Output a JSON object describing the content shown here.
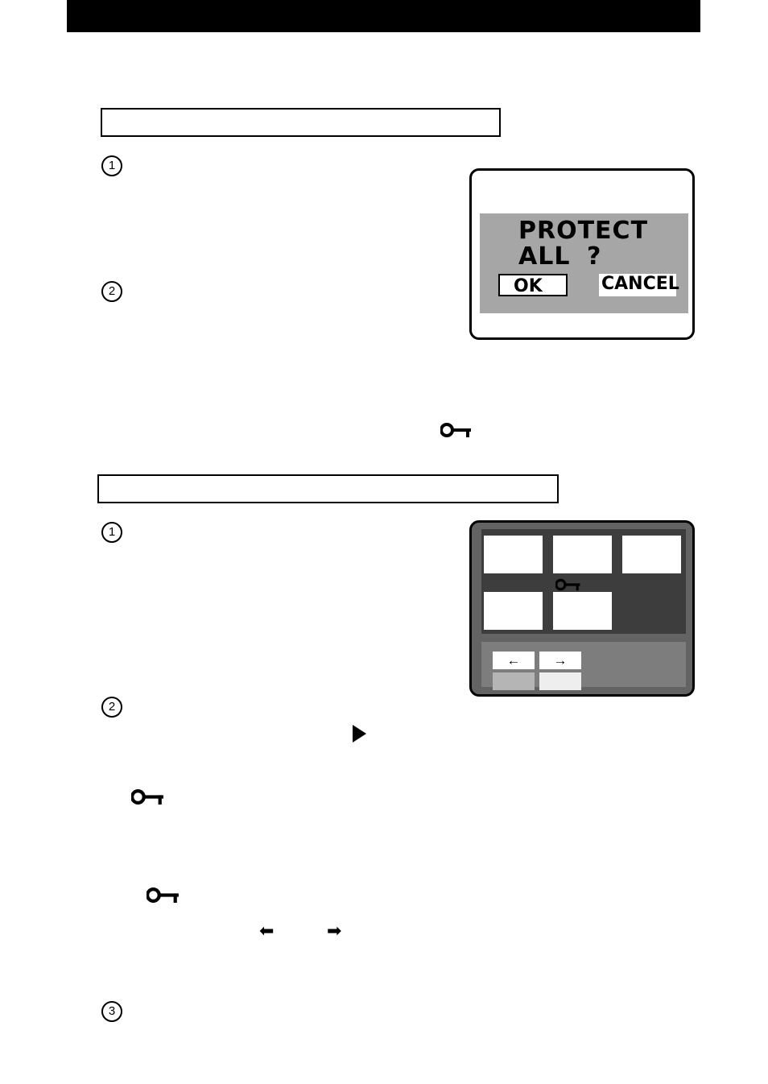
{
  "page": {
    "header_bar_color": "#000000",
    "background": "#ffffff"
  },
  "sections": [
    {
      "id": "protect-all",
      "title": "",
      "steps": [
        {
          "label": "1"
        },
        {
          "label": "2"
        }
      ]
    },
    {
      "id": "protect-selected",
      "title": "",
      "steps": [
        {
          "label": "1"
        },
        {
          "label": "2"
        },
        {
          "label": "3"
        }
      ]
    }
  ],
  "lcd_dialog": {
    "line1": "PROTECT",
    "line2": "ALL",
    "question_mark": "?",
    "ok_label": "OK",
    "cancel_label": "CANCEL",
    "screen_color": "#a6a6a6",
    "frame_color": "#000000"
  },
  "index_screen": {
    "thumbnails": [
      "",
      "",
      "",
      "",
      ""
    ],
    "protect_icon": "key-icon",
    "controls": {
      "left_arrow": "←",
      "right_arrow": "→",
      "button3_label": "",
      "button4_label": ""
    },
    "panel_color": "#636363",
    "thumb_area_color": "#3d3d3d",
    "control_area_color": "#7d7d7d"
  },
  "inline_glyphs": {
    "key_icon_name": "key-icon",
    "play_icon_name": "play-triangle-icon",
    "left_arrow": "⬅",
    "right_arrow": "➡"
  }
}
